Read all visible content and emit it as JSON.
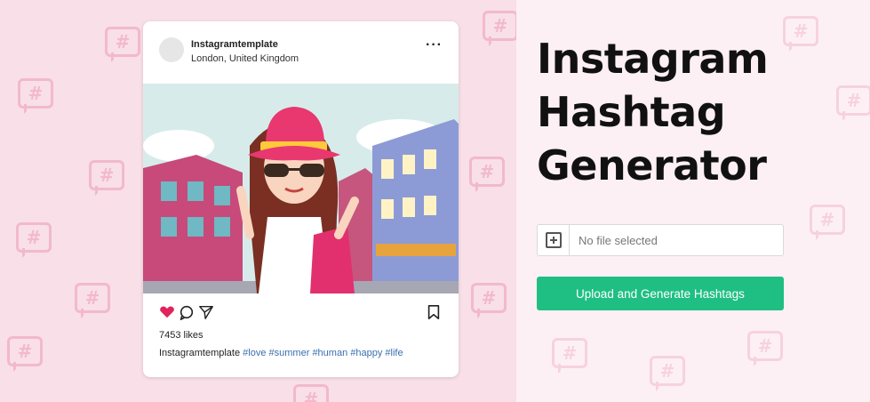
{
  "post": {
    "username": "Instagramtemplate",
    "location": "London, United Kingdom",
    "more_icon": "more-dots-icon",
    "likes": "7453 likes",
    "caption_user": "Instagramtemplate",
    "hashtags": [
      "#love",
      "#summer",
      "#human",
      "#happy",
      "#life"
    ],
    "icons": [
      "heart-icon",
      "comment-icon",
      "share-icon",
      "bookmark-icon"
    ]
  },
  "generator": {
    "title_lines": [
      "Instagram",
      "Hashtag",
      "Generator"
    ],
    "file_status": "No file selected",
    "upload_label": "Upload and Generate Hashtags"
  },
  "background_glyph": "#",
  "colors": {
    "accent_green": "#1fbf83",
    "heart_red": "#e0245e",
    "hashtag_blue": "#3a6fb0",
    "left_bg": "#f9dfe8",
    "right_bg": "#fdf0f4"
  }
}
